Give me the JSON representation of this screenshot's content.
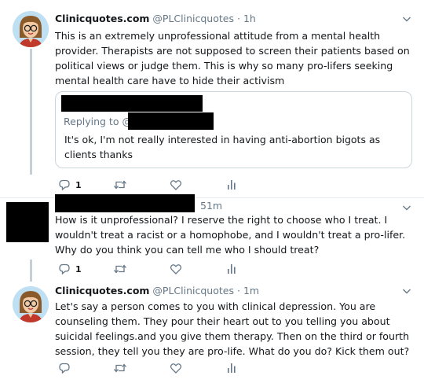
{
  "tweets": [
    {
      "author_name": "Clinicquotes.com",
      "handle": "@PLClinicquotes",
      "separator": "·",
      "time": "1h",
      "text": "This is an extremely unprofessional attitude from a mental health provider. Therapists are not supposed to screen their patients based on political views or judge them. This is why so many pro-lifers seeking mental health care have to hide their activism",
      "quoted": {
        "replying_to": "Replying to @",
        "text": "It's ok, I'm not really interested in having anti-abortion bigots as clients thanks"
      },
      "reply_count": "1"
    },
    {
      "time": "51m",
      "text": "How is it unprofessional? I reserve the right to choose who I treat. I wouldn't treat a racist or a homophobe, and I wouldn't treat a pro-lifer. Why do you think you can tell me who I should treat?",
      "reply_count": "1"
    },
    {
      "author_name": "Clinicquotes.com",
      "handle": "@PLClinicquotes",
      "separator": "·",
      "time": "1m",
      "text": "Let's say a person comes to you with clinical depression. You are counseling them. They pour their heart out to you telling you about suicidal feelings.and you give them therapy. Then on the third or fourth session, they tell you they are pro-life. What do you do? Kick them out?"
    }
  ],
  "icons": {
    "reply": "reply-icon",
    "retweet": "retweet-icon",
    "like": "heart-icon",
    "analytics": "analytics-icon",
    "menu": "chevron-down-icon"
  },
  "colors": {
    "text": "#14171a",
    "secondary": "#657786",
    "thread_line": "#c4cfd6",
    "border": "#ccd6dd",
    "redaction": "#000000"
  }
}
